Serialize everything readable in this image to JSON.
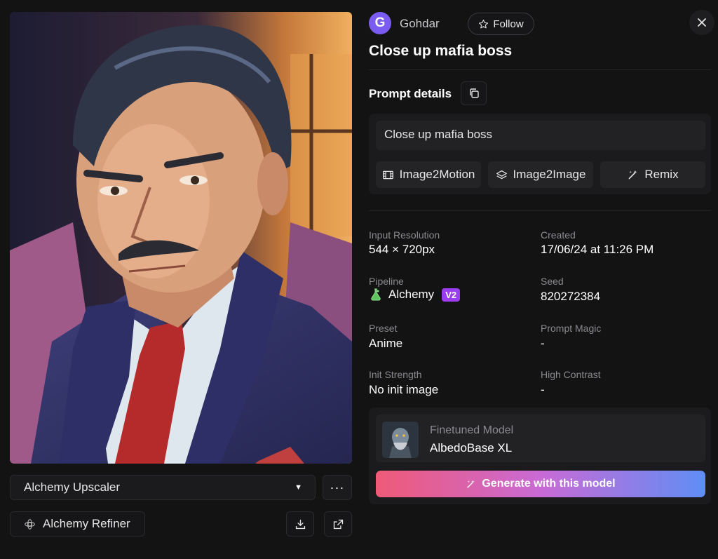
{
  "image": {
    "alt_icon": "portrait-image"
  },
  "left_controls": {
    "upscaler_label": "Alchemy Upscaler",
    "more_label": "···",
    "refiner_label": "Alchemy Refiner"
  },
  "header": {
    "avatar_letter": "G",
    "username": "Gohdar",
    "follow_label": "Follow",
    "title": "Close up mafia boss"
  },
  "prompt": {
    "section_label": "Prompt details",
    "text": "Close up mafia boss",
    "actions": [
      {
        "label": "Image2Motion",
        "icon": "film-icon"
      },
      {
        "label": "Image2Image",
        "icon": "layers-icon"
      },
      {
        "label": "Remix",
        "icon": "wand-icon"
      }
    ]
  },
  "details": {
    "input_resolution": {
      "label": "Input Resolution",
      "value": "544 × 720px"
    },
    "created": {
      "label": "Created",
      "value": "17/06/24 at 11:26 PM"
    },
    "pipeline": {
      "label": "Pipeline",
      "value": "Alchemy",
      "badge": "V2"
    },
    "seed": {
      "label": "Seed",
      "value": "820272384"
    },
    "preset": {
      "label": "Preset",
      "value": "Anime"
    },
    "prompt_magic": {
      "label": "Prompt Magic",
      "value": "-"
    },
    "init_strength": {
      "label": "Init Strength",
      "value": "No init image"
    },
    "high_contrast": {
      "label": "High Contrast",
      "value": "-"
    }
  },
  "model": {
    "type_label": "Finetuned Model",
    "name": "AlbedoBase XL",
    "generate_label": "Generate with this model"
  },
  "colors": {
    "background": "#131313",
    "avatar": "#7b5cf2",
    "badge": "#9b3df0",
    "gradient_start": "#ef5a77",
    "gradient_end": "#5f8ef5"
  }
}
